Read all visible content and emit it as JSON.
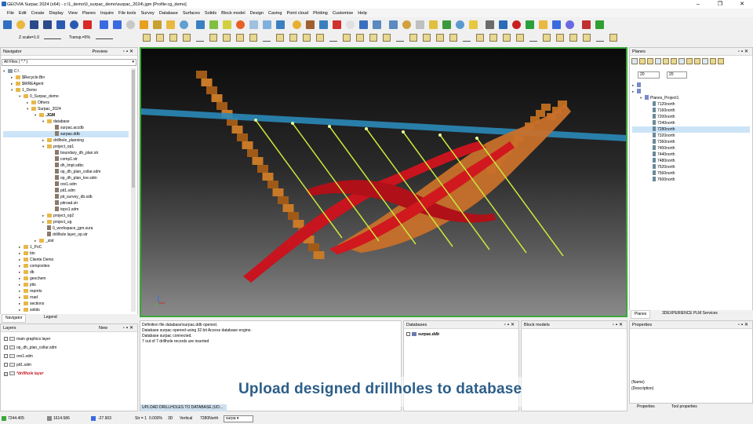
{
  "window": {
    "title": "GEOVIA Surpac 2024 (x64) - c:\\1_demo\\0_surpac_demo\\surpac_2024\\.jgm [Profile:cg_demo]",
    "minimize": "–",
    "maximize": "❐",
    "close": "✕"
  },
  "menu": [
    "File",
    "Edit",
    "Create",
    "Display",
    "View",
    "Planes",
    "Inquire",
    "File tools",
    "Survey",
    "Database",
    "Surfaces",
    "Solids",
    "Block model",
    "Design",
    "Caving",
    "Point cloud",
    "Plotting",
    "Customise",
    "Help"
  ],
  "toolbar": {
    "zscale": "Z scale=1.0",
    "transp": "Transp.=0%"
  },
  "navigator": {
    "title": "Navigator",
    "preview_label": "Preview",
    "filter": "All Files ( *.* )",
    "tree": [
      {
        "label": "C:\\",
        "depth": 0,
        "kind": "drive",
        "exp": "▾"
      },
      {
        "label": "$Recycle.Bin",
        "depth": 1,
        "kind": "folder",
        "exp": "▸"
      },
      {
        "label": "$WREAgent",
        "depth": 1,
        "kind": "folder",
        "exp": "▸"
      },
      {
        "label": "1_Demo",
        "depth": 1,
        "kind": "folder",
        "exp": "▾"
      },
      {
        "label": "0_Surpac_demo",
        "depth": 2,
        "kind": "folder",
        "exp": "▾"
      },
      {
        "label": "Others",
        "depth": 3,
        "kind": "folder",
        "exp": "▸"
      },
      {
        "label": "Surpac_2024",
        "depth": 3,
        "kind": "folder",
        "exp": "▾"
      },
      {
        "label": ".JGM",
        "depth": 4,
        "kind": "folder",
        "exp": "▾",
        "bold": true
      },
      {
        "label": "database",
        "depth": 5,
        "kind": "folder",
        "exp": "▾"
      },
      {
        "label": "surpac.accdb",
        "depth": 6,
        "kind": "file",
        "exp": ""
      },
      {
        "label": "surpac.ddb",
        "depth": 6,
        "kind": "file",
        "exp": "",
        "selected": true
      },
      {
        "label": "drillhole_planning",
        "depth": 5,
        "kind": "folder",
        "exp": "▸"
      },
      {
        "label": "project_op1",
        "depth": 5,
        "kind": "folder",
        "exp": "▾"
      },
      {
        "label": "boundary_dh_plan.str",
        "depth": 6,
        "kind": "file",
        "exp": ""
      },
      {
        "label": "comp1.str",
        "depth": 6,
        "kind": "file",
        "exp": ""
      },
      {
        "label": "dh_lmpt.sdbc",
        "depth": 6,
        "kind": "file",
        "exp": ""
      },
      {
        "label": "op_dh_plan_collar.sdm",
        "depth": 6,
        "kind": "file",
        "exp": ""
      },
      {
        "label": "op_dh_plan_toe.sdm",
        "depth": 6,
        "kind": "file",
        "exp": ""
      },
      {
        "label": "ore1.sdm",
        "depth": 6,
        "kind": "file",
        "exp": ""
      },
      {
        "label": "pit1.sdm",
        "depth": 6,
        "kind": "file",
        "exp": ""
      },
      {
        "label": "pit_survey_db.sdb",
        "depth": 6,
        "kind": "file",
        "exp": ""
      },
      {
        "label": "pitroad.str",
        "depth": 6,
        "kind": "file",
        "exp": ""
      },
      {
        "label": "topo1.sdm",
        "depth": 6,
        "kind": "file",
        "exp": ""
      },
      {
        "label": "project_op2",
        "depth": 5,
        "kind": "folder",
        "exp": "▸"
      },
      {
        "label": "project_ug",
        "depth": 5,
        "kind": "folder",
        "exp": "▸"
      },
      {
        "label": "0_workspace_jgm.sura",
        "depth": 5,
        "kind": "file",
        "exp": ""
      },
      {
        "label": "drillhole layer_op.str",
        "depth": 5,
        "kind": "file",
        "exp": ""
      },
      {
        "label": "_stst",
        "depth": 4,
        "kind": "folder",
        "exp": "▸"
      },
      {
        "label": "1_PoC",
        "depth": 2,
        "kind": "folder",
        "exp": "▸"
      },
      {
        "label": "bin",
        "depth": 2,
        "kind": "folder",
        "exp": "▸"
      },
      {
        "label": "Cliente Demo",
        "depth": 2,
        "kind": "folder",
        "exp": "▸"
      },
      {
        "label": "composites",
        "depth": 2,
        "kind": "folder",
        "exp": "▸"
      },
      {
        "label": "db",
        "depth": 2,
        "kind": "folder",
        "exp": "▸"
      },
      {
        "label": "geochem",
        "depth": 2,
        "kind": "folder",
        "exp": "▸"
      },
      {
        "label": "pits",
        "depth": 2,
        "kind": "folder",
        "exp": "▸"
      },
      {
        "label": "reports",
        "depth": 2,
        "kind": "folder",
        "exp": "▸"
      },
      {
        "label": "road",
        "depth": 2,
        "kind": "folder",
        "exp": "▸"
      },
      {
        "label": "sections",
        "depth": 2,
        "kind": "folder",
        "exp": "▸"
      },
      {
        "label": "solids",
        "depth": 2,
        "kind": "folder",
        "exp": "▸"
      }
    ],
    "tabs": [
      "Navigator",
      "Legend"
    ]
  },
  "layers": {
    "title": "Layers",
    "new_label": "New",
    "items": [
      {
        "label": "main graphics layer",
        "active": false
      },
      {
        "label": "op_dh_plan_collar.sdm",
        "active": false
      },
      {
        "label": "ore1.sdm",
        "active": false
      },
      {
        "label": "pit1.sdm",
        "active": false
      },
      {
        "label": "*drillhole layer",
        "active": true
      }
    ]
  },
  "output": {
    "lines": [
      "Definition file database\\surpac.ddb opened.",
      "Database surpac opened using 32 bit Access database engine.",
      "Database surpac connected.",
      "7 out of 7 drillhole records are inserted"
    ],
    "status_text": "UPLOAD DRILLHOLES TO DATABASE (UD..."
  },
  "databases": {
    "title": "Databases",
    "items": [
      "surpac.ddb"
    ]
  },
  "block_models": {
    "title": "Block models"
  },
  "planes": {
    "title": "Planes",
    "spin1": "20",
    "spin2": "20",
    "project": "Planes_Project1",
    "items": [
      "7120north",
      "7160north",
      "7200north",
      "7240north",
      "7280north",
      "7320north",
      "7360north",
      "7400north",
      "7440north",
      "7480north",
      "7520north",
      "7560north",
      "7600north"
    ],
    "selected_index": 4,
    "tabs": [
      "Planes",
      "3DEXPERIENCE PLM Services"
    ]
  },
  "properties": {
    "title": "Properties",
    "name_label": "(Name)",
    "desc_label": "(Description)",
    "tabs": [
      "Properties",
      "Tool properties"
    ]
  },
  "caption": "Upload designed drillholes to database",
  "statusbar": {
    "y": "7244.405",
    "x": "1614.586",
    "z": "-27.903",
    "str": "Str = 1",
    "zoom": "0.000%",
    "mode": "3D",
    "view": "Vertical",
    "plane": "7280North",
    "layer": "surpa"
  },
  "colors": {
    "viewport_border": "#3aa63a",
    "caption": "#2c5e88",
    "ore": "#c8141e",
    "drill": "#c8e83c",
    "plane": "#2a8ab8",
    "bench": "#c87a28"
  }
}
